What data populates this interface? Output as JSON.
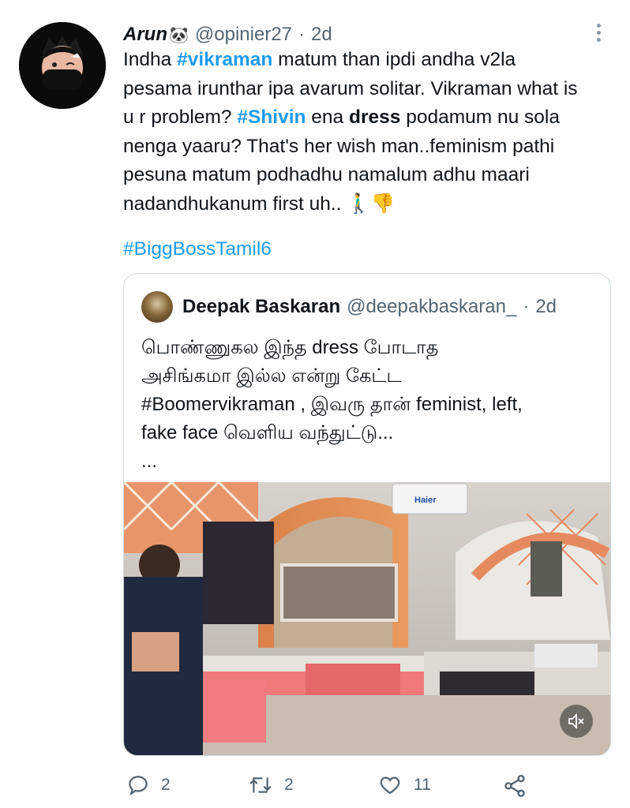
{
  "tweet": {
    "author_name": "Arun",
    "author_emoji": "🐼",
    "handle": "@opinier27",
    "separator": "·",
    "time": "2d",
    "text": {
      "l1_a": "Indha ",
      "l1_tag": "#vikraman",
      "l1_b": " matum than ipdi andha v2la",
      "l2": "pesama irunthar ipa avarum solitar. Vikraman what is",
      "l3_a": "u r problem? ",
      "l3_tag": "#Shivin",
      "l3_b": " ena ",
      "l3_bold": "dress",
      "l3_c": " podamum nu sola",
      "l4": "nenga yaaru? That's her wish man..feminism pathi",
      "l5": "pesuna matum podhadhu namalum adhu maari",
      "l6": "nadandhukanum first uh.. 🚶‍♂️👎"
    },
    "hashtag": "#BiggBossTamil6"
  },
  "quote": {
    "author_name": "Deepak Baskaran",
    "handle": "@deepakbaskaran_",
    "separator": "·",
    "time": "2d",
    "lines": [
      "பொண்ணுகல இந்த dress போடாத",
      "அசிங்கமா இல்ல என்று கேட்ட",
      "#Boomervikraman , இவரு தான் feminist, left,",
      "fake face வெளிய வந்துட்டு...",
      "..."
    ],
    "ac_brand": "Haier"
  },
  "actions": {
    "replies": "2",
    "retweets": "2",
    "likes": "11"
  },
  "icons": {
    "reply": "reply-icon",
    "retweet": "retweet-icon",
    "like": "heart-icon",
    "share": "share-icon",
    "more": "more-vertical-icon",
    "mute": "muted-speaker-icon"
  },
  "colors": {
    "link": "#1d9bf0",
    "secondary_text": "#536471",
    "border": "#cfd9de"
  }
}
